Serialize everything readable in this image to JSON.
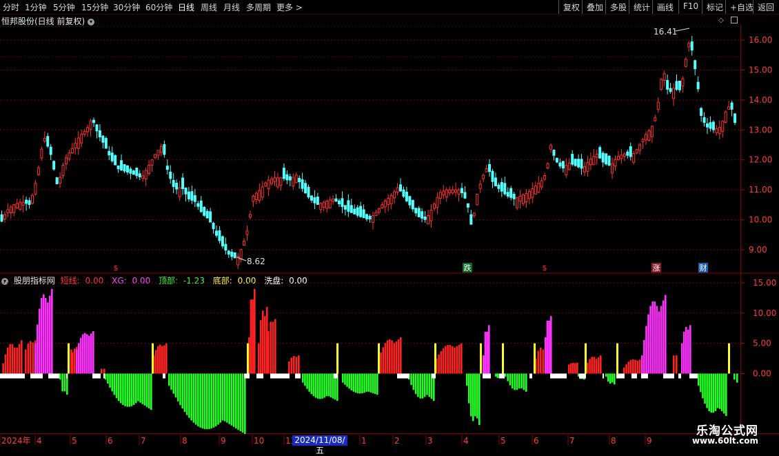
{
  "toolbar": {
    "periods": [
      "分时",
      "1分钟",
      "5分钟",
      "15分钟",
      "30分钟",
      "60分钟",
      "日线",
      "周线",
      "月线",
      "多周期",
      "更多 >"
    ],
    "active_period": "日线",
    "right_buttons": [
      "复权",
      "叠加",
      "多股",
      "统计",
      "画线",
      "F10",
      "标记",
      "+自选",
      "返回"
    ]
  },
  "header": {
    "title": "恒邦股份(日线 前复权)"
  },
  "indicator": {
    "name": "股朋指标网",
    "fields": [
      {
        "label": "短线:",
        "value": "0.00",
        "color": "#ff3333"
      },
      {
        "label": "XG:",
        "value": "0.00",
        "color": "#ff44ff"
      },
      {
        "label": "顶部:",
        "value": "-1.23",
        "color": "#33ff33"
      },
      {
        "label": "底部:",
        "value": "0.00",
        "color": "#ffff33"
      },
      {
        "label": "洗盘:",
        "value": "0.00",
        "color": "#ffffff"
      }
    ]
  },
  "price_annotations": {
    "high": "16.41",
    "low": "8.62"
  },
  "markers": [
    {
      "text": "$",
      "color": "#ff3333",
      "bg": "none"
    },
    {
      "text": "跌",
      "color": "#ffffff",
      "bg": "#0c6b22"
    },
    {
      "text": "$",
      "color": "#ff3333",
      "bg": "none"
    },
    {
      "text": "涨",
      "color": "#ffffff",
      "bg": "#8a1a2a"
    },
    {
      "text": "财",
      "color": "#ffffff",
      "bg": "#1a5fae"
    }
  ],
  "xaxis": {
    "labels": [
      "2024年",
      "4",
      "5",
      "6",
      "7",
      "8",
      "9",
      "10",
      "11",
      "1",
      "2",
      "3",
      "4",
      "5",
      "6",
      "7",
      "8",
      "9"
    ],
    "highlight": "2024/11/08/五"
  },
  "watermark": {
    "line1": "乐淘公式网",
    "line2": "www.60lt.com"
  },
  "chart_data": [
    {
      "type": "candlestick",
      "title": "恒邦股份(日线 前复权)",
      "yticks": [
        9.0,
        10.0,
        11.0,
        12.0,
        13.0,
        14.0,
        15.0,
        16.0
      ],
      "ylim": [
        8.4,
        16.55
      ],
      "high": 16.41,
      "low": 8.62,
      "close_path": [
        [
          0,
          9.9
        ],
        [
          8,
          10.3
        ],
        [
          18,
          10.5
        ],
        [
          30,
          10.6
        ],
        [
          42,
          10.5
        ],
        [
          52,
          11.4
        ],
        [
          62,
          12.8
        ],
        [
          72,
          12.2
        ],
        [
          82,
          11.1
        ],
        [
          92,
          12.0
        ],
        [
          104,
          12.4
        ],
        [
          114,
          12.8
        ],
        [
          124,
          13.0
        ],
        [
          132,
          13.4
        ],
        [
          140,
          12.9
        ],
        [
          150,
          12.5
        ],
        [
          160,
          12.0
        ],
        [
          170,
          11.7
        ],
        [
          182,
          11.6
        ],
        [
          194,
          11.5
        ],
        [
          204,
          11.4
        ],
        [
          214,
          11.8
        ],
        [
          224,
          12.2
        ],
        [
          234,
          12.5
        ],
        [
          242,
          11.6
        ],
        [
          252,
          11.0
        ],
        [
          262,
          11.1
        ],
        [
          272,
          10.7
        ],
        [
          282,
          10.6
        ],
        [
          292,
          10.2
        ],
        [
          302,
          10.0
        ],
        [
          312,
          9.5
        ],
        [
          322,
          9.1
        ],
        [
          332,
          8.8
        ],
        [
          342,
          8.7
        ],
        [
          350,
          9.1
        ],
        [
          358,
          9.7
        ],
        [
          366,
          10.8
        ],
        [
          376,
          11.0
        ],
        [
          386,
          11.3
        ],
        [
          396,
          11.4
        ],
        [
          408,
          11.4
        ],
        [
          418,
          11.3
        ],
        [
          428,
          11.5
        ],
        [
          438,
          11.0
        ],
        [
          448,
          10.7
        ],
        [
          458,
          10.5
        ],
        [
          470,
          10.6
        ],
        [
          482,
          10.7
        ],
        [
          492,
          10.5
        ],
        [
          502,
          10.3
        ],
        [
          512,
          10.2
        ],
        [
          522,
          10.1
        ],
        [
          534,
          10.0
        ],
        [
          546,
          10.3
        ],
        [
          556,
          10.6
        ],
        [
          566,
          10.8
        ],
        [
          576,
          11.1
        ],
        [
          586,
          10.7
        ],
        [
          596,
          10.4
        ],
        [
          606,
          10.1
        ],
        [
          616,
          10.0
        ],
        [
          626,
          10.4
        ],
        [
          636,
          10.9
        ],
        [
          646,
          11.0
        ],
        [
          656,
          11.0
        ],
        [
          666,
          11.0
        ],
        [
          676,
          10.6
        ],
        [
          683,
          9.7
        ],
        [
          690,
          10.8
        ],
        [
          698,
          11.4
        ],
        [
          706,
          11.8
        ],
        [
          714,
          11.2
        ],
        [
          724,
          11.0
        ],
        [
          734,
          10.8
        ],
        [
          744,
          10.7
        ],
        [
          754,
          10.8
        ],
        [
          764,
          10.9
        ],
        [
          774,
          11.1
        ],
        [
          784,
          11.3
        ],
        [
          792,
          11.6
        ],
        [
          796,
          12.6
        ],
        [
          804,
          12.0
        ],
        [
          814,
          11.7
        ],
        [
          824,
          11.9
        ],
        [
          834,
          11.8
        ],
        [
          844,
          11.7
        ],
        [
          854,
          12.0
        ],
        [
          864,
          12.2
        ],
        [
          874,
          11.9
        ],
        [
          884,
          11.8
        ],
        [
          894,
          12.1
        ],
        [
          904,
          12.2
        ],
        [
          914,
          12.1
        ],
        [
          924,
          12.4
        ],
        [
          934,
          12.8
        ],
        [
          944,
          13.1
        ],
        [
          952,
          13.6
        ],
        [
          956,
          14.6
        ],
        [
          962,
          14.9
        ],
        [
          968,
          14.2
        ],
        [
          976,
          14.4
        ],
        [
          984,
          14.3
        ],
        [
          990,
          14.8
        ],
        [
          996,
          15.8
        ],
        [
          1000,
          16.0
        ],
        [
          1004,
          15.4
        ],
        [
          1010,
          14.6
        ],
        [
          1016,
          13.4
        ],
        [
          1024,
          13.1
        ],
        [
          1034,
          13.0
        ],
        [
          1044,
          13.1
        ],
        [
          1054,
          13.8
        ],
        [
          1060,
          13.7
        ],
        [
          1066,
          13.1
        ]
      ]
    },
    {
      "type": "bar",
      "title": "股朋指标网",
      "yticks": [
        0.0,
        5.0,
        10.0,
        15.0
      ],
      "ylim": [
        -7.5,
        16.0
      ],
      "series": [
        {
          "name": "短线",
          "color": "#ff2222",
          "segments": [
            [
              0,
              30,
              0,
              5.5
            ],
            [
              36,
              50,
              4.0,
              5.5
            ],
            [
              98,
              102,
              4.0,
              4.0
            ],
            [
              104,
              116,
              3.5,
              4.5
            ],
            [
              146,
              150,
              0.8,
              0.8
            ],
            [
              222,
              240,
              3.0,
              5.0
            ],
            [
              360,
              368,
              6.0,
              14.0
            ],
            [
              374,
              386,
              5.0,
              11.0
            ],
            [
              388,
              398,
              7.0,
              9.0
            ],
            [
              418,
              432,
              2.0,
              3.0
            ],
            [
              548,
              580,
              2.5,
              6.0
            ],
            [
              632,
              668,
              2.5,
              5.0
            ],
            [
              696,
              700,
              1.5,
              2.0
            ],
            [
              776,
              790,
              2.5,
              4.5
            ],
            [
              824,
              836,
              1.5,
              1.8
            ],
            [
              848,
              870,
              1.0,
              3.0
            ],
            [
              904,
              930,
              1.0,
              2.5
            ],
            [
              976,
              980,
              3.0,
              3.0
            ]
          ]
        },
        {
          "name": "XG",
          "color": "#ff33ff",
          "segments": [
            [
              50,
              74,
              5.0,
              14.0
            ],
            [
              110,
              134,
              4.0,
              7.0
            ],
            [
              700,
              708,
              3.0,
              8.0
            ],
            [
              790,
              798,
              6.0,
              9.5
            ],
            [
              930,
              964,
              3.0,
              13.0
            ],
            [
              988,
              1000,
              5.0,
              8.0
            ]
          ]
        },
        {
          "name": "顶部",
          "color": "#22ff22",
          "segments": [
            [
              86,
              96,
              -1.0,
              -3.5
            ],
            [
              152,
              218,
              -1.0,
              -6.0
            ],
            [
              244,
              354,
              -2.0,
              -10.0
            ],
            [
              438,
              488,
              -1.5,
              -4.5
            ],
            [
              496,
              546,
              -1.5,
              -3.5
            ],
            [
              592,
              628,
              -1.0,
              -4.5
            ],
            [
              676,
              694,
              -2.0,
              -8.5
            ],
            [
              718,
              726,
              -0.5,
              -0.8
            ],
            [
              732,
              762,
              -0.5,
              -3.0
            ],
            [
              838,
              846,
              -0.5,
              -1.0
            ],
            [
              878,
              890,
              -0.5,
              -1.8
            ],
            [
              1012,
              1052,
              -2.0,
              -7.0
            ],
            [
              1064,
              1068,
              -1.0,
              -1.5
            ]
          ]
        },
        {
          "name": "底部",
          "color": "#ffff22",
          "x": [
            98,
            220,
            358,
            488,
            548,
            630,
            696,
            728,
            774,
            848,
            894,
            1056
          ],
          "values": [
            5.0,
            5.0,
            5.0,
            5.0,
            5.0,
            5.0,
            5.0,
            5.0,
            5.0,
            5.0,
            5.0,
            5.0
          ]
        },
        {
          "name": "洗盘",
          "color": "#ffffff",
          "value": -0.8
        }
      ]
    }
  ]
}
